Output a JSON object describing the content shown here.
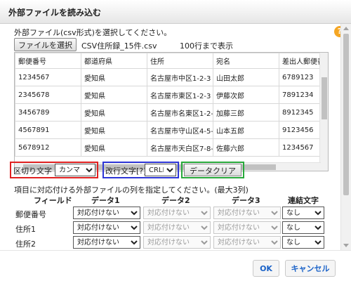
{
  "dialog": {
    "title": "外部ファイルを読み込む"
  },
  "file_section": {
    "instruction": "外部ファイル(csv形式)を選択してください。",
    "select_button": "ファイルを選択",
    "file_name": "CSV住所録_15件.csv",
    "row_limit": "100行まで表示",
    "help_icon": "?"
  },
  "preview_table": {
    "headers": [
      "郵便番号",
      "都道府県",
      "住所",
      "宛名",
      "差出人郵便番号"
    ],
    "rows": [
      [
        "1234567",
        "愛知県",
        "名古屋市中区1-2-3",
        "山田太郎",
        "6789123"
      ],
      [
        "2345678",
        "愛知県",
        "名古屋市東区1-2-3",
        "伊藤次郎",
        "7891234"
      ],
      [
        "3456789",
        "愛知県",
        "名古屋市名東区1-2-3",
        "加藤三郎",
        "8912345"
      ],
      [
        "4567891",
        "愛知県",
        "名古屋市守山区4-5-6",
        "山本五郎",
        "9123456"
      ],
      [
        "5678912",
        "愛知県",
        "名古屋市天白区7-8-9",
        "佐藤六郎",
        "1234567"
      ]
    ]
  },
  "options": {
    "delimiter_label": "区切り文字",
    "delimiter_value": "カンマ",
    "newline_label": "改行文字[?]",
    "newline_value": "CRLF",
    "clear_button": "データクリア"
  },
  "mapping": {
    "instruction": "項目に対応付ける外部ファイルの列を指定してください。(最大3列)",
    "headers": {
      "field": "フィールド",
      "data1": "データ1",
      "data2": "データ2",
      "data3": "データ3",
      "joiner": "連結文字"
    },
    "rows": [
      {
        "field": "郵便番号",
        "data1": "対応付けない",
        "data2": "対応付けない",
        "data3": "対応付けない",
        "joiner": "なし"
      },
      {
        "field": "住所1",
        "data1": "対応付けない",
        "data2": "対応付けない",
        "data3": "対応付けない",
        "joiner": "なし"
      },
      {
        "field": "住所2",
        "data1": "対応付けない",
        "data2": "対応付けない",
        "data3": "対応付けない",
        "joiner": "なし"
      }
    ]
  },
  "footer": {
    "ok": "OK",
    "cancel": "キャンセル"
  },
  "colors": {
    "highlight_red": "#e02020",
    "highlight_blue": "#2d35d6",
    "highlight_green": "#28a93a",
    "help_icon": "#f5a623",
    "button_text": "#1a62c8"
  }
}
